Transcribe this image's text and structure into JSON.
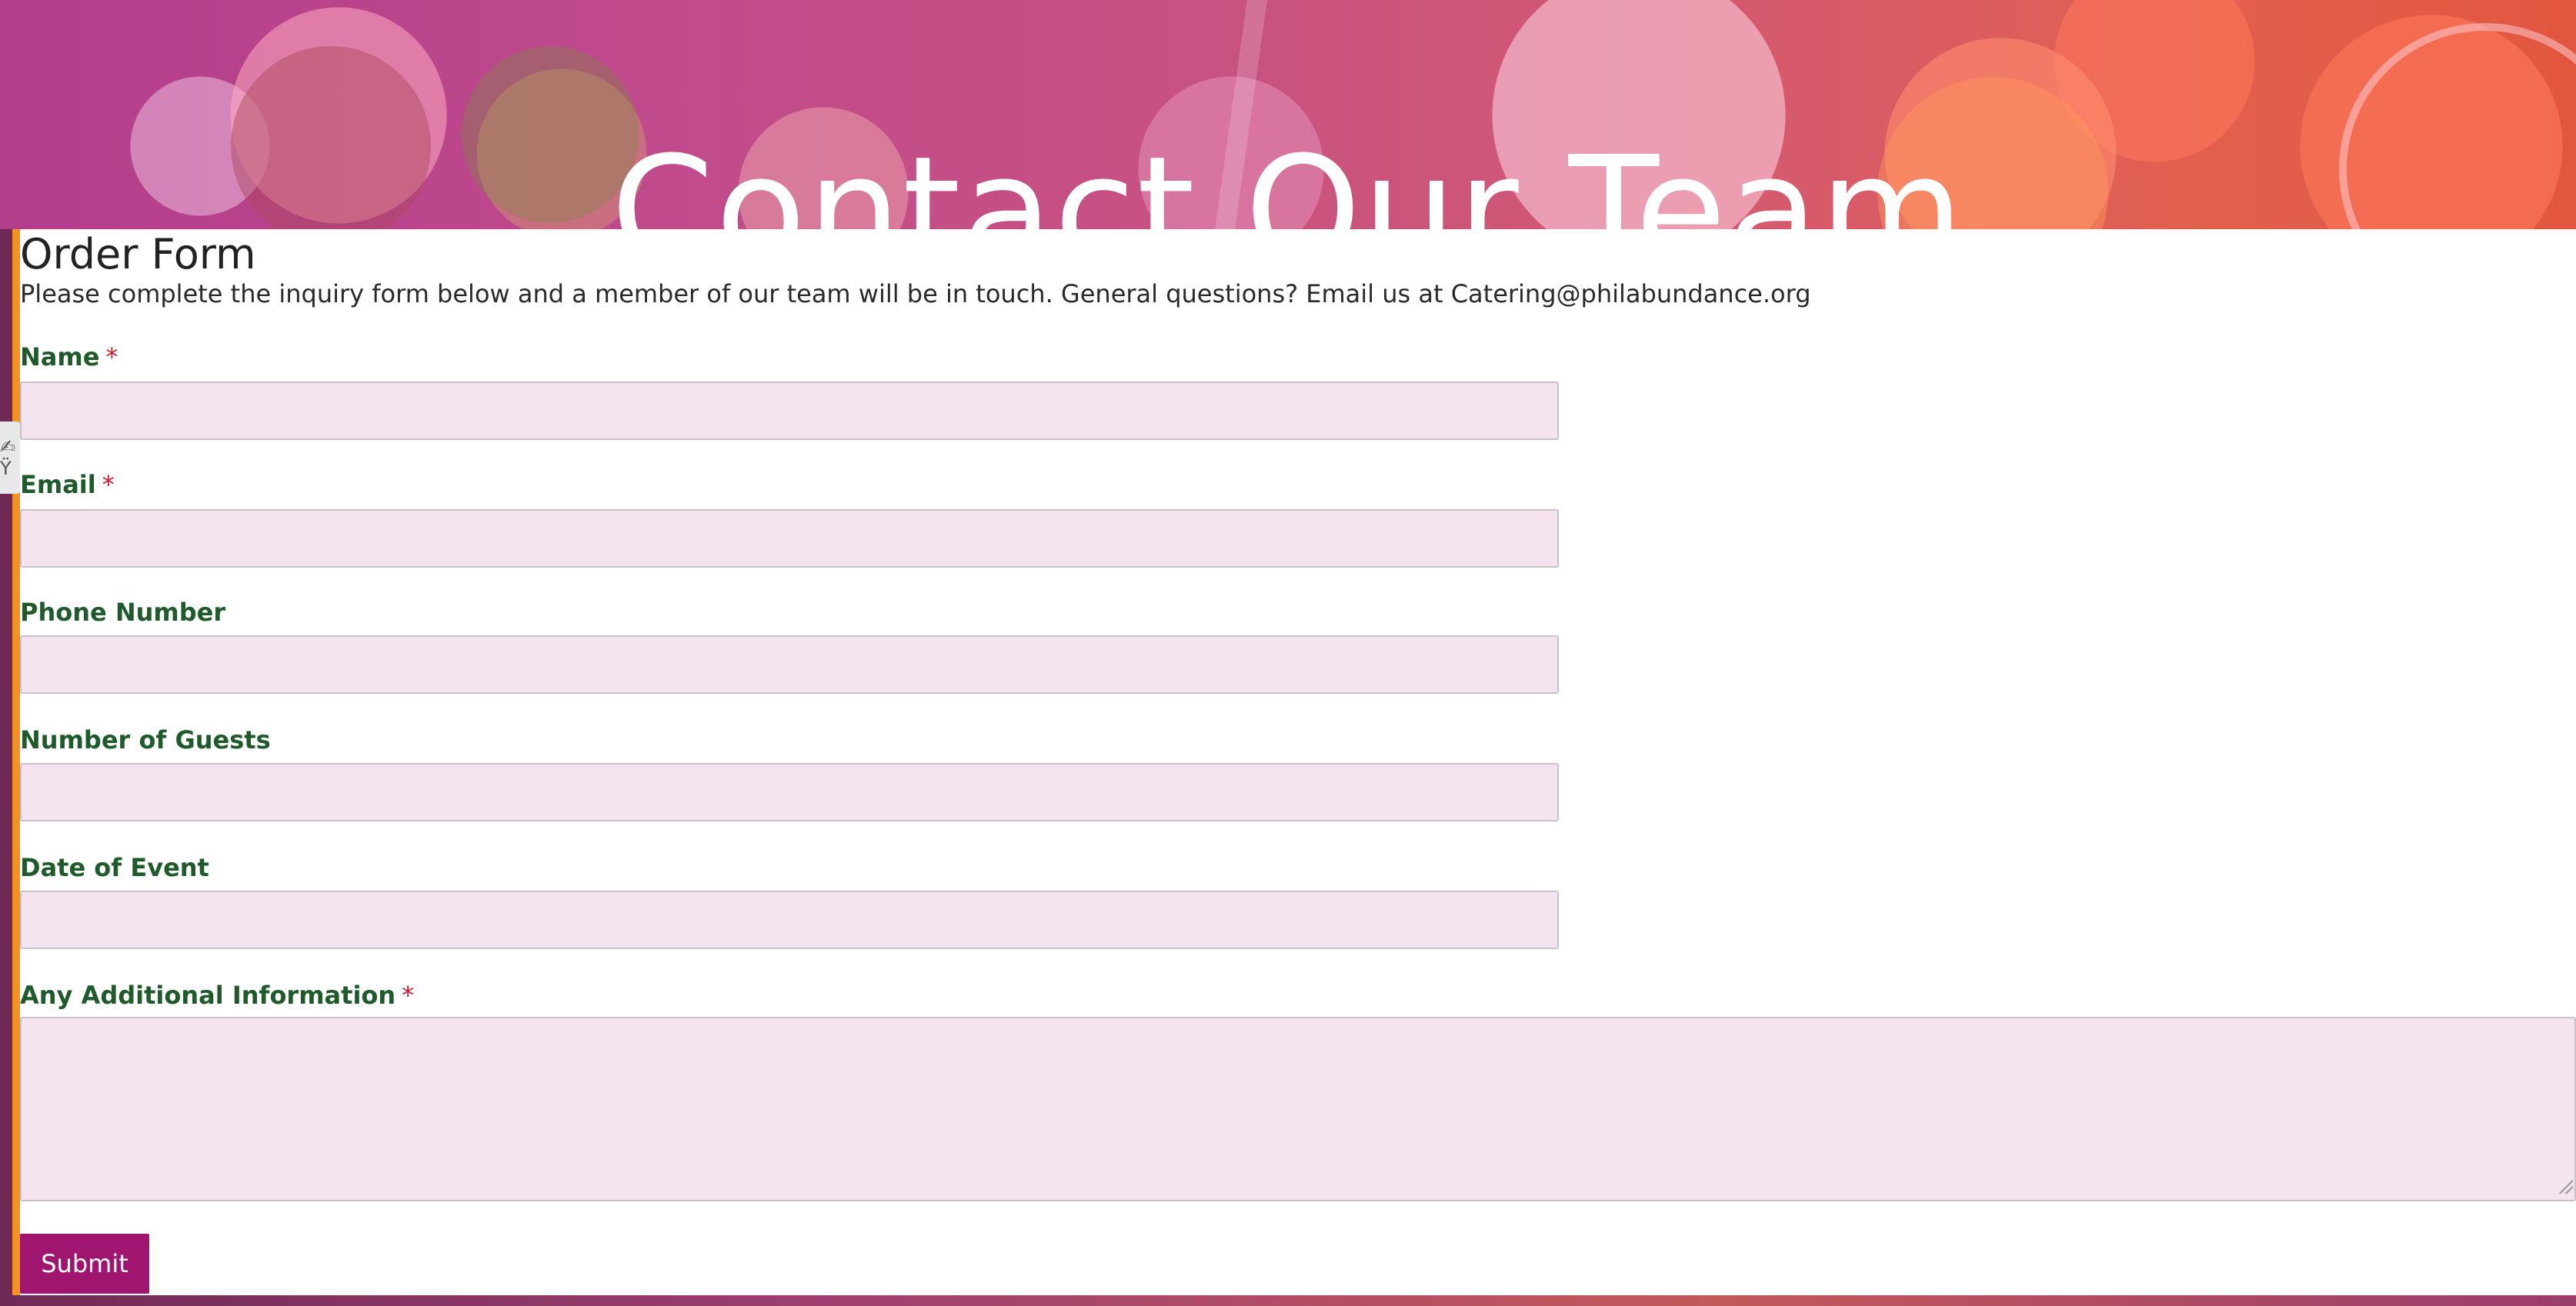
{
  "hero": {
    "title": "Contact Our Team"
  },
  "form": {
    "title": "Order Form",
    "description": "Please complete the inquiry form below and a member of our team will be in touch. General questions? Email us at Catering@philabundance.org",
    "fields": [
      {
        "label": "Name",
        "required": "*",
        "value": ""
      },
      {
        "label": "Email",
        "required": "*",
        "value": ""
      },
      {
        "label": "Phone Number",
        "required": "",
        "value": ""
      },
      {
        "label": "Number of Guests",
        "required": "",
        "value": ""
      },
      {
        "label": "Date of Event",
        "required": "",
        "value": ""
      },
      {
        "label": "Any Additional Information",
        "required": "*",
        "value": ""
      }
    ],
    "submit_label": "Submit"
  },
  "side_tab": {
    "icon": "accessibility-icon",
    "glyph": "✍Ÿ"
  },
  "colors": {
    "label_green": "#1f5a2a",
    "required_red": "#d0182c",
    "input_bg": "#f3e4ef",
    "submit_bg": "#a0156f",
    "accent_orange": "#f39221"
  }
}
